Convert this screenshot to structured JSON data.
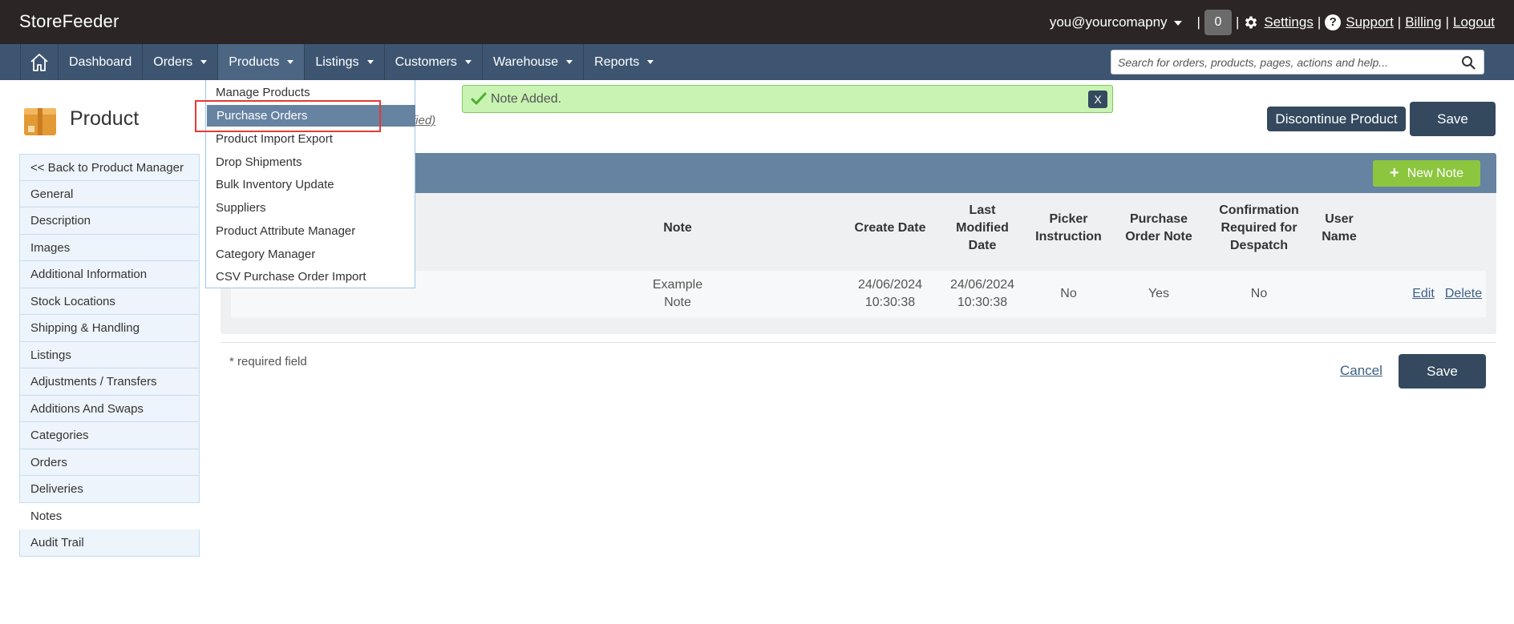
{
  "app": {
    "brand": "StoreFeeder"
  },
  "topbar": {
    "user": "you@yourcomapny",
    "notification_count": "0",
    "settings": "Settings",
    "support": "Support",
    "billing": "Billing",
    "logout": "Logout",
    "sep": "|"
  },
  "nav": {
    "items": [
      {
        "label": "Dashboard",
        "dropdown": false
      },
      {
        "label": "Orders",
        "dropdown": true
      },
      {
        "label": "Products",
        "dropdown": true
      },
      {
        "label": "Listings",
        "dropdown": true
      },
      {
        "label": "Customers",
        "dropdown": true
      },
      {
        "label": "Warehouse",
        "dropdown": true
      },
      {
        "label": "Reports",
        "dropdown": true
      }
    ],
    "search_placeholder": "Search for orders, products, pages, actions and help..."
  },
  "products_menu": {
    "items": [
      "Manage Products",
      "Purchase Orders",
      "Product Import Export",
      "Drop Shipments",
      "Bulk Inventory Update",
      "Suppliers",
      "Product Attribute Manager",
      "Category Manager",
      "CSV Purchase Order Import"
    ],
    "hovered_index": 1
  },
  "page": {
    "title": "Product",
    "modified_fragment": "fied)",
    "discontinue_label": "Discontinue Product",
    "save_label": "Save",
    "cancel_label": "Cancel",
    "required_note": "* required field"
  },
  "toast": {
    "message": "Note Added.",
    "close_label": "X"
  },
  "sidenav": {
    "items": [
      "<< Back to Product Manager",
      "General",
      "Description",
      "Images",
      "Additional Information",
      "Stock Locations",
      "Shipping & Handling",
      "Listings",
      "Adjustments / Transfers",
      "Additions And Swaps",
      "Categories",
      "Orders",
      "Deliveries",
      "Notes",
      "Audit Trail"
    ],
    "selected_index": 13
  },
  "notes": {
    "new_note_label": "New Note",
    "columns": {
      "note": "Note",
      "create_date": "Create Date",
      "last_modified": "Last Modified Date",
      "picker": "Picker Instruction",
      "po_note": "Purchase Order Note",
      "confirmation": "Confirmation Required for Despatch",
      "user": "User Name"
    },
    "rows": [
      {
        "note": "Example Note",
        "create_date": "24/06/2024 10:30:38",
        "last_modified": "24/06/2024 10:30:38",
        "picker": "No",
        "po_note": "Yes",
        "confirmation": "No",
        "user": "",
        "edit": "Edit",
        "delete": "Delete"
      }
    ]
  },
  "colors": {
    "topbar": "#2b2525",
    "navbar": "#3d5571",
    "panel_header": "#6683a2",
    "accent_green": "#8cc63f",
    "button_dark": "#34495e",
    "toast_bg": "#c9f3b3",
    "highlight": "#e53935"
  }
}
